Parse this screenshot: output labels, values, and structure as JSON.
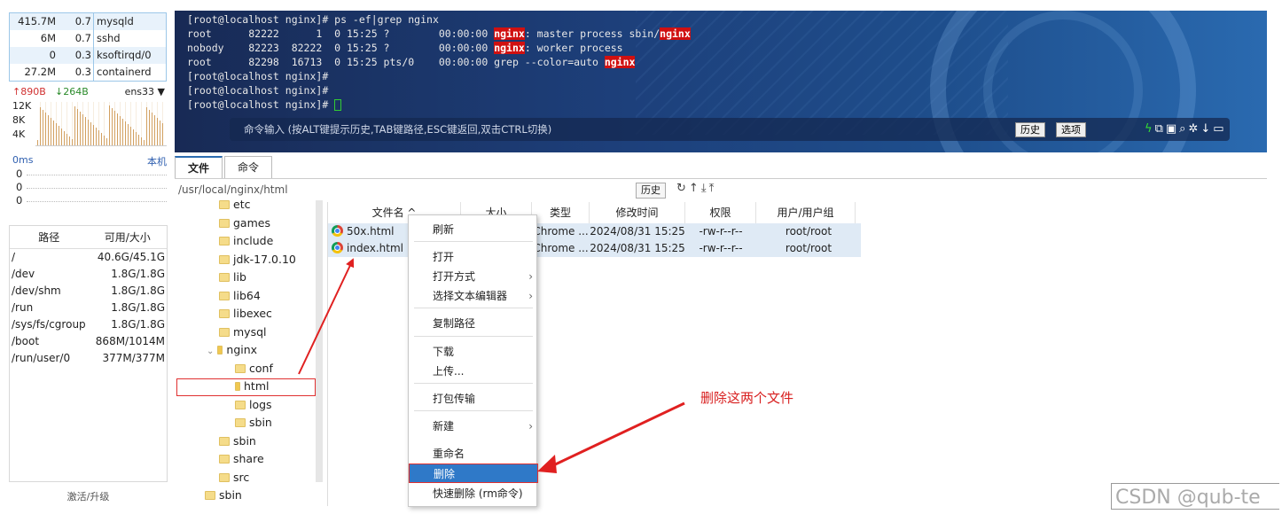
{
  "sidebar": {
    "processes": [
      {
        "mem": "415.7M",
        "cpu": "0.7",
        "name": "mysqld"
      },
      {
        "mem": "6M",
        "cpu": "0.7",
        "name": "sshd"
      },
      {
        "mem": "0",
        "cpu": "0.3",
        "name": "ksoftirqd/0"
      },
      {
        "mem": "27.2M",
        "cpu": "0.3",
        "name": "containerd"
      }
    ],
    "network": {
      "up": "↑890B",
      "down": "↓264B",
      "interface": "ens33 ▼",
      "axis": [
        "12K",
        "8K",
        "4K"
      ]
    },
    "latency": {
      "label": "0ms",
      "host": "本机",
      "values": [
        "0",
        "0",
        "0"
      ]
    },
    "disk": {
      "headers": [
        "路径",
        "可用/大小"
      ],
      "rows": [
        {
          "path": "/",
          "usage": "40.6G/45.1G"
        },
        {
          "path": "/dev",
          "usage": "1.8G/1.8G"
        },
        {
          "path": "/dev/shm",
          "usage": "1.8G/1.8G"
        },
        {
          "path": "/run",
          "usage": "1.8G/1.8G"
        },
        {
          "path": "/sys/fs/cgroup",
          "usage": "1.8G/1.8G"
        },
        {
          "path": "/boot",
          "usage": "868M/1014M"
        },
        {
          "path": "/run/user/0",
          "usage": "377M/377M"
        }
      ]
    },
    "activate": "激活/升级"
  },
  "terminal": {
    "lines": [
      {
        "pre": "[root@localhost nginx]# ps -ef|grep nginx",
        "hl": "",
        "post": ""
      },
      {
        "pre": "root      82222      1  0 15:25 ?        00:00:00 ",
        "hl": "nginx",
        "post": ": master process sbin/",
        "hl2": "nginx"
      },
      {
        "pre": "nobody    82223  82222  0 15:25 ?        00:00:00 ",
        "hl": "nginx",
        "post": ": worker process"
      },
      {
        "pre": "root      82298  16713  0 15:25 pts/0    00:00:00 grep --color=auto ",
        "hl": "nginx",
        "post": ""
      },
      {
        "pre": "[root@localhost nginx]#",
        "hl": "",
        "post": ""
      },
      {
        "pre": "[root@localhost nginx]#",
        "hl": "",
        "post": ""
      },
      {
        "pre": "[root@localhost nginx]# ",
        "hl": "",
        "post": ""
      }
    ],
    "cmd_hint": "命令输入 (按ALT键提示历史,TAB键路径,ESC键返回,双击CTRL切换)",
    "history_btn": "历史",
    "options_btn": "选项"
  },
  "tabs": [
    "文件",
    "命令"
  ],
  "path": {
    "value": "/usr/local/nginx/html",
    "history_btn": "历史"
  },
  "tree": [
    {
      "label": "etc",
      "indent": 1,
      "type": "folder"
    },
    {
      "label": "games",
      "indent": 1,
      "type": "folder"
    },
    {
      "label": "include",
      "indent": 1,
      "type": "folder"
    },
    {
      "label": "jdk-17.0.10",
      "indent": 1,
      "type": "folder"
    },
    {
      "label": "lib",
      "indent": 1,
      "type": "folder"
    },
    {
      "label": "lib64",
      "indent": 1,
      "type": "folder"
    },
    {
      "label": "libexec",
      "indent": 1,
      "type": "folder"
    },
    {
      "label": "mysql",
      "indent": 1,
      "type": "folder"
    },
    {
      "label": "nginx",
      "indent": 1,
      "type": "open"
    },
    {
      "label": "conf",
      "indent": 2,
      "type": "folder"
    },
    {
      "label": "html",
      "indent": 2,
      "type": "open"
    },
    {
      "label": "logs",
      "indent": 2,
      "type": "folder"
    },
    {
      "label": "sbin",
      "indent": 2,
      "type": "folder"
    },
    {
      "label": "sbin",
      "indent": 1,
      "type": "folder"
    },
    {
      "label": "share",
      "indent": 1,
      "type": "folder"
    },
    {
      "label": "src",
      "indent": 1,
      "type": "folder"
    },
    {
      "label": "sbin",
      "indent": 0,
      "type": "folder"
    }
  ],
  "files": {
    "headers": [
      "文件名 ^",
      "大小",
      "类型",
      "修改时间",
      "权限",
      "用户/用户组"
    ],
    "rows": [
      {
        "name": "50x.html",
        "type": "Chrome ...",
        "mtime": "2024/08/31 15:25",
        "perm": "-rw-r--r--",
        "owner": "root/root"
      },
      {
        "name": "index.html",
        "type": "Chrome ...",
        "mtime": "2024/08/31 15:25",
        "perm": "-rw-r--r--",
        "owner": "root/root"
      }
    ]
  },
  "menu": {
    "items": [
      "刷新",
      "打开",
      "打开方式",
      "选择文本编辑器",
      "复制路径",
      "下载",
      "上传...",
      "打包传输",
      "新建",
      "重命名",
      "删除",
      "快速删除 (rm命令)"
    ]
  },
  "annotation": "删除这两个文件",
  "watermark": "CSDN @qub-te",
  "colors": {
    "accent": "#2f79c8",
    "annotation": "#d82020",
    "highlight": "#d01010"
  }
}
